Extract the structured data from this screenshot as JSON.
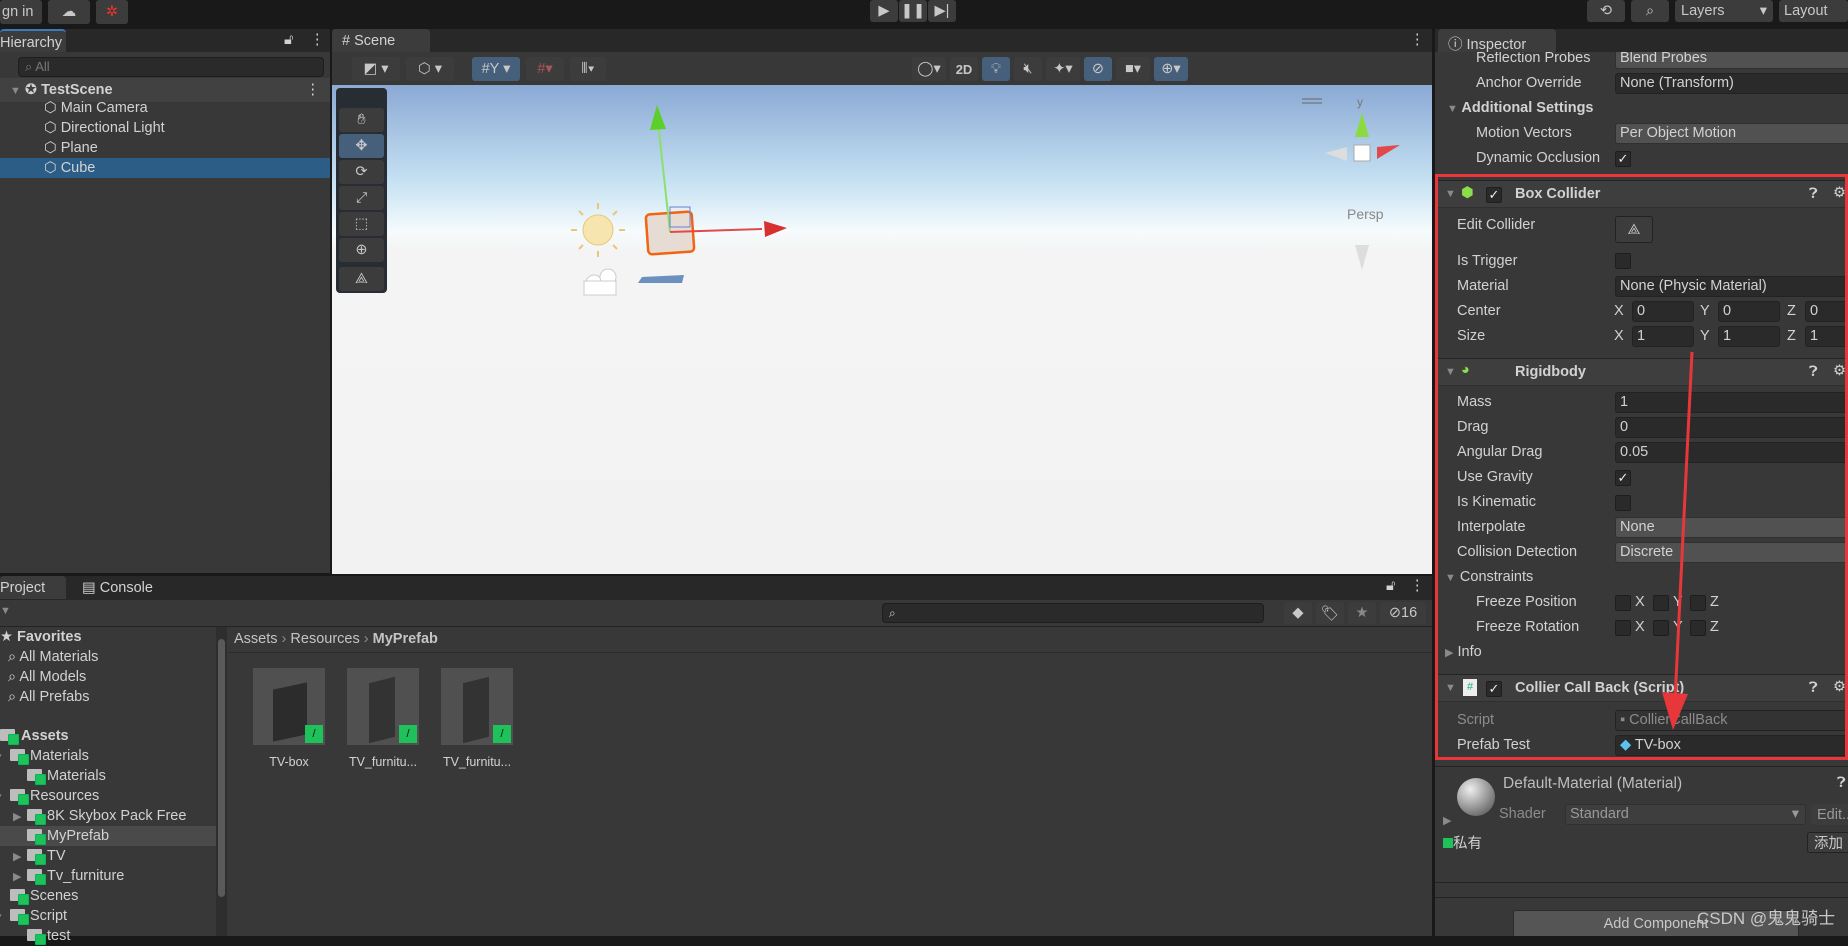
{
  "toolbar": {
    "sign_in": "gn in",
    "layers": "Layers",
    "layout": "Layout"
  },
  "hierarchy": {
    "tab": "Hierarchy",
    "search_placeholder": "All",
    "scene": "TestScene",
    "items": [
      "Main Camera",
      "Directional Light",
      "Plane",
      "Cube"
    ],
    "selected": "Cube"
  },
  "scene": {
    "tab": "Scene",
    "mode_2d": "2D",
    "persp": "Persp",
    "axis_y": "y"
  },
  "inspector": {
    "tab": "Inspector",
    "mesh_renderer": {
      "reflection_probes_label": "Reflection Probes",
      "reflection_probes": "Blend Probes",
      "anchor_override_label": "Anchor Override",
      "anchor_override": "None (Transform)",
      "additional_settings": "Additional Settings",
      "motion_vectors_label": "Motion Vectors",
      "motion_vectors": "Per Object Motion",
      "dynamic_occlusion_label": "Dynamic Occlusion",
      "dynamic_occlusion": true
    },
    "box_collider": {
      "title": "Box Collider",
      "enabled": true,
      "edit_collider": "Edit Collider",
      "is_trigger_label": "Is Trigger",
      "is_trigger": false,
      "material_label": "Material",
      "material": "None (Physic Material)",
      "center_label": "Center",
      "center": {
        "x": "0",
        "y": "0",
        "z": "0"
      },
      "size_label": "Size",
      "size": {
        "x": "1",
        "y": "1",
        "z": "1"
      }
    },
    "rigidbody": {
      "title": "Rigidbody",
      "mass_label": "Mass",
      "mass": "1",
      "drag_label": "Drag",
      "drag": "0",
      "angular_drag_label": "Angular Drag",
      "angular_drag": "0.05",
      "use_gravity_label": "Use Gravity",
      "use_gravity": true,
      "is_kinematic_label": "Is Kinematic",
      "is_kinematic": false,
      "interpolate_label": "Interpolate",
      "interpolate": "None",
      "collision_detection_label": "Collision Detection",
      "collision_detection": "Discrete",
      "constraints": "Constraints",
      "freeze_position": "Freeze Position",
      "freeze_rotation": "Freeze Rotation",
      "info": "Info",
      "x": "X",
      "y": "Y",
      "z": "Z"
    },
    "script": {
      "title": "Collier Call Back (Script)",
      "enabled": true,
      "script_label": "Script",
      "script": "CollierCallBack",
      "prefab_test_label": "Prefab Test",
      "prefab_test": "TV-box"
    },
    "material": {
      "title": "Default-Material (Material)",
      "shader_label": "Shader",
      "shader": "Standard",
      "edit": "Edit...",
      "private": "私有",
      "add": "添加"
    },
    "add_component": "Add Component"
  },
  "project": {
    "tab": "Project",
    "console_tab": "Console",
    "hidden_count": "16",
    "favorites": "Favorites",
    "favorite_items": [
      "All Materials",
      "All Models",
      "All Prefabs"
    ],
    "assets": "Assets",
    "tree": [
      {
        "label": "Materials",
        "depth": 1,
        "arrow": "▾"
      },
      {
        "label": "Materials",
        "depth": 2,
        "arrow": ""
      },
      {
        "label": "Resources",
        "depth": 1,
        "arrow": "▾"
      },
      {
        "label": "8K Skybox Pack Free",
        "depth": 2,
        "arrow": "▶"
      },
      {
        "label": "MyPrefab",
        "depth": 2,
        "arrow": "",
        "selected": true
      },
      {
        "label": "TV",
        "depth": 2,
        "arrow": "▶"
      },
      {
        "label": "Tv_furniture",
        "depth": 2,
        "arrow": "▶"
      },
      {
        "label": "Scenes",
        "depth": 1,
        "arrow": ""
      },
      {
        "label": "Script",
        "depth": 1,
        "arrow": "▾"
      },
      {
        "label": "test",
        "depth": 2,
        "arrow": ""
      }
    ],
    "breadcrumb": [
      "Assets",
      "Resources",
      "MyPrefab"
    ],
    "files": [
      "TV-box",
      "TV_furnitu...",
      "TV_furnitu..."
    ]
  },
  "watermark": "CSDN @鬼鬼骑士",
  "colors": {
    "annotation": "#e8373a",
    "selection": "#2c5d87",
    "active_tool": "#46607c"
  }
}
